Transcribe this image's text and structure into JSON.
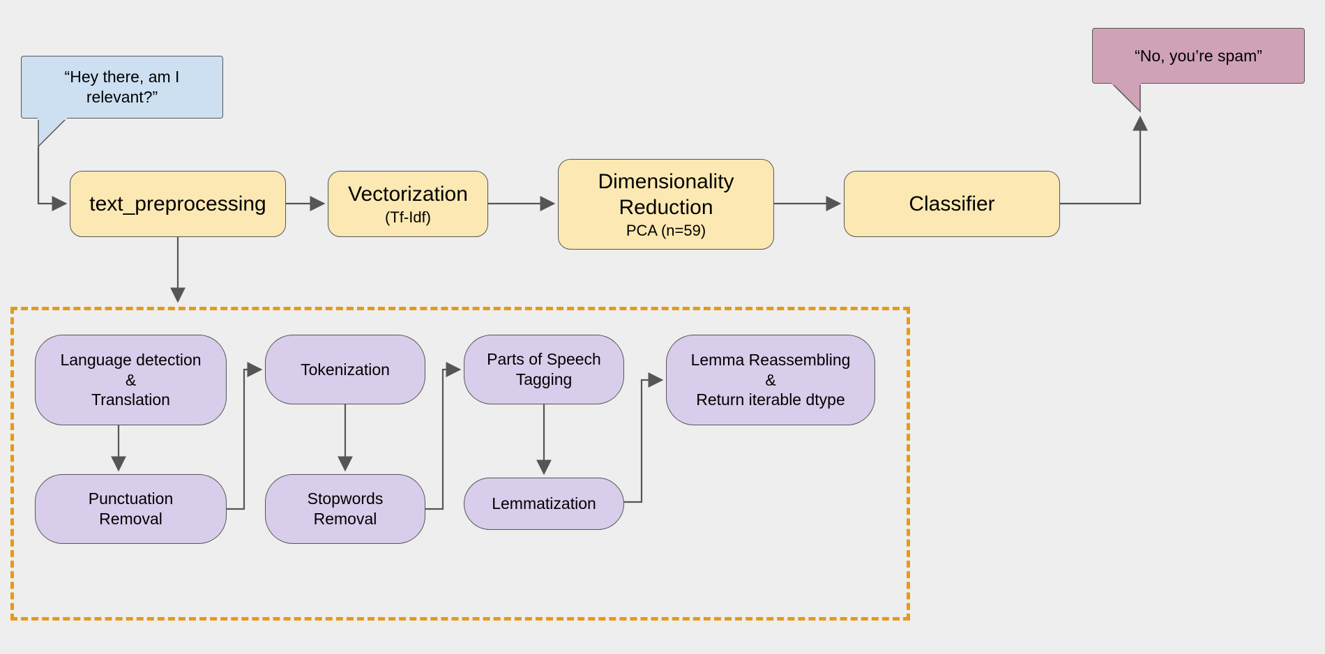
{
  "speech_in": "“Hey there, am I relevant?”",
  "speech_out": "“No, you’re spam”",
  "pipeline": {
    "preproc": "text_preprocessing",
    "vectorize_title": "Vectorization",
    "vectorize_sub": "(Tf-Idf)",
    "dimred_title": "Dimensionality Reduction",
    "dimred_sub": "PCA (n=59)",
    "classifier": "Classifier"
  },
  "steps": {
    "lang": "Language detection\n&\nTranslation",
    "punct": "Punctuation Removal",
    "token": "Tokenization",
    "stop": "Stopwords Removal",
    "pos": "Parts of Speech Tagging",
    "lemma": "Lemmatization",
    "reasm": "Lemma Reassembling\n&\nReturn iterable dtype"
  }
}
